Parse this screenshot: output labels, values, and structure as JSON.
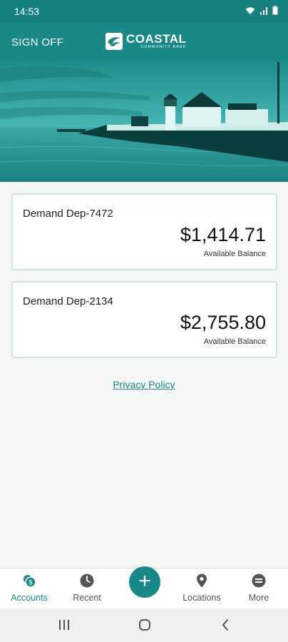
{
  "status_bar": {
    "time": "14:53"
  },
  "header": {
    "sign_off_label": "SIGN OFF",
    "logo_name": "COASTAL",
    "logo_sub": "COMMUNITY BANK"
  },
  "accounts": [
    {
      "name": "Demand Dep-7472",
      "balance": "$1,414.71",
      "balance_label": "Available Balance"
    },
    {
      "name": "Demand Dep-2134",
      "balance": "$2,755.80",
      "balance_label": "Available Balance"
    }
  ],
  "privacy_link": "Privacy Policy",
  "bottom_nav": {
    "items": [
      {
        "label": "Accounts",
        "icon": "accounts-icon"
      },
      {
        "label": "Recent",
        "icon": "clock-icon"
      },
      {
        "label": "Locations",
        "icon": "location-pin-icon"
      },
      {
        "label": "More",
        "icon": "more-icon"
      }
    ],
    "fab_symbol": "+"
  },
  "colors": {
    "primary": "#198987",
    "status_bar": "#16807e",
    "card_border": "#c9e7e6"
  }
}
